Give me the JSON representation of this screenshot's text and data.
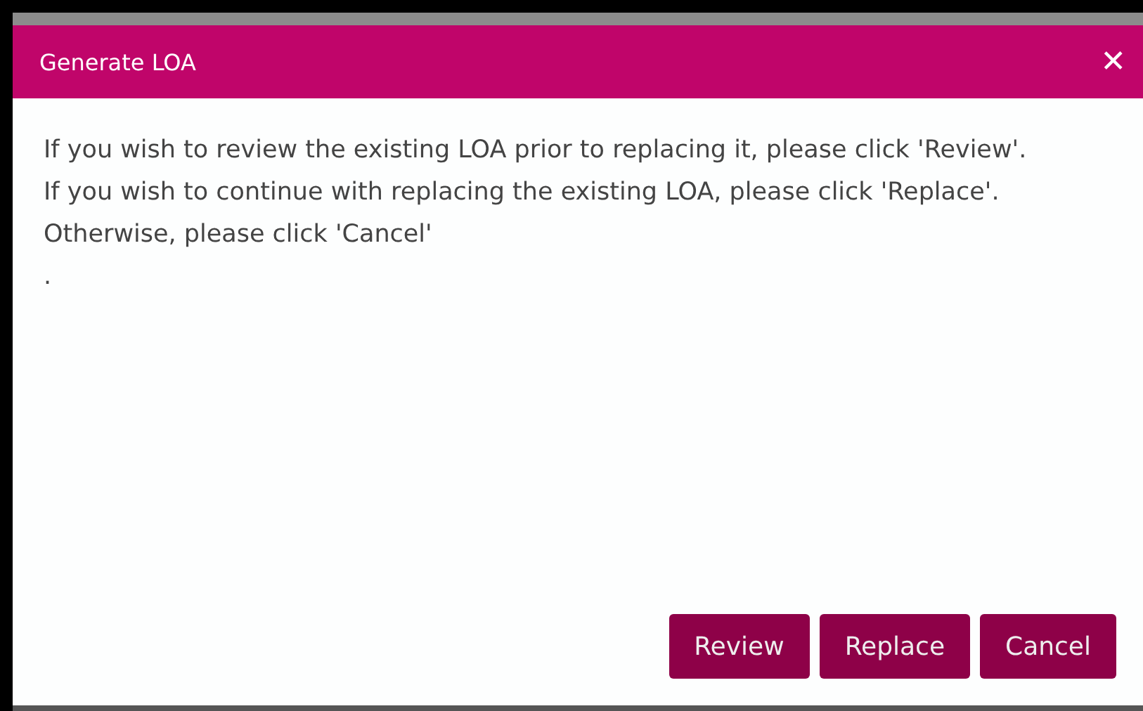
{
  "dialog": {
    "title": "Generate LOA",
    "close": "✕",
    "message": [
      "If you wish to review the existing LOA prior to replacing it, please click 'Review'.",
      "If you wish to continue with replacing the existing LOA, please click 'Replace'.",
      "Otherwise, please click 'Cancel'",
      "."
    ],
    "buttons": [
      "Review",
      "Replace",
      "Cancel"
    ]
  }
}
